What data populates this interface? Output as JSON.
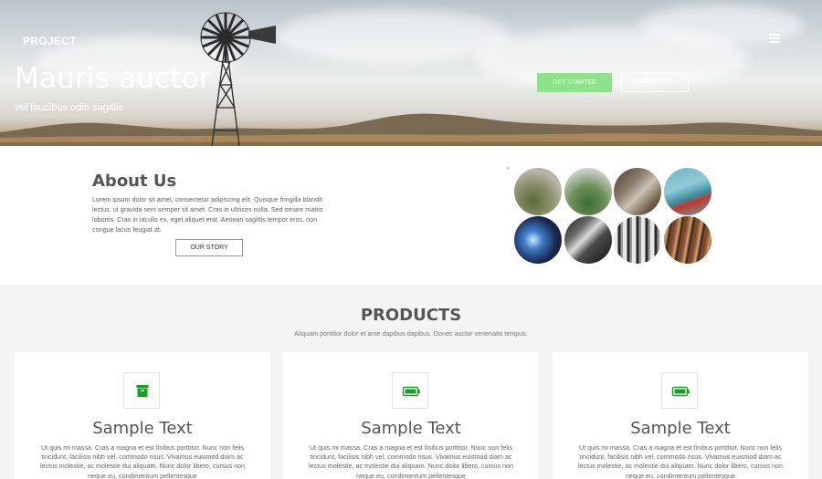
{
  "header": {
    "brand": "PROJECT",
    "title": "Mauris auctor",
    "subtitle": "vel faucibus odio sagittis",
    "primary_button": "GET STARTED",
    "secondary_button": "MORE INFO"
  },
  "about": {
    "title": "About Us",
    "text": "Lorem ipsum dolor sit amet, consectetur adipiscing elit. Quisque fringilla blandit lectus, ut gravida sem semper sit amet. Cras in ultrices nulla. Sed ornare mattis lobortis. Cras in iaculis ex, eget aliquet erat. Aenean sagittis tempor eros, non congue lacus feugiat at.",
    "button": "OUR STORY"
  },
  "gallery": {
    "images": [
      "hillside-photo",
      "green-valley-photo",
      "workbench-photo",
      "tools-board-photo",
      "welding-photo",
      "wrench-photo",
      "spark-plugs-photo",
      "hanging-tools-photo"
    ]
  },
  "products": {
    "title": "PRODUCTS",
    "subtitle": "Aliquam porttitor dolor et ante dapibus dapibus. Donec auctor venenatis tempus.",
    "cards": [
      {
        "icon": "archive-box-icon",
        "title": "Sample Text",
        "text": "Ut quis mi massa. Cras a magna et est finibus porttitor. Nunc non felis tincidunt, facilisis nibh vel, commodo risus. Vivamus euismod diam ac lectus molestie, ac molestie dui aliquam. Nunc dolor libero, cursus non neque eu, condimentum pellentesque"
      },
      {
        "icon": "battery-icon",
        "title": "Sample Text",
        "text": "Ut quis mi massa. Cras a magna et est finibus porttitor. Nunc non felis tincidunt, facilisis nibh vel, commodo risus. Vivamus euismod diam ac lectus molestie, ac molestie dui aliquam. Nunc dolor libero, cursus non neque eu, condimentum pellentesque"
      },
      {
        "icon": "battery-icon",
        "title": "Sample Text",
        "text": "Ut quis mi massa. Cras a magna et est finibus porttitor. Nunc non felis tincidunt, facilisis nibh vel, commodo risus. Vivamus euismod diam ac lectus molestie, ac molestie dui aliquam. Nunc dolor libero, cursus non neque eu, condimentum pellentesque"
      }
    ]
  },
  "colors": {
    "accent": "#8de28a",
    "icon_green": "#1f9b2a"
  }
}
